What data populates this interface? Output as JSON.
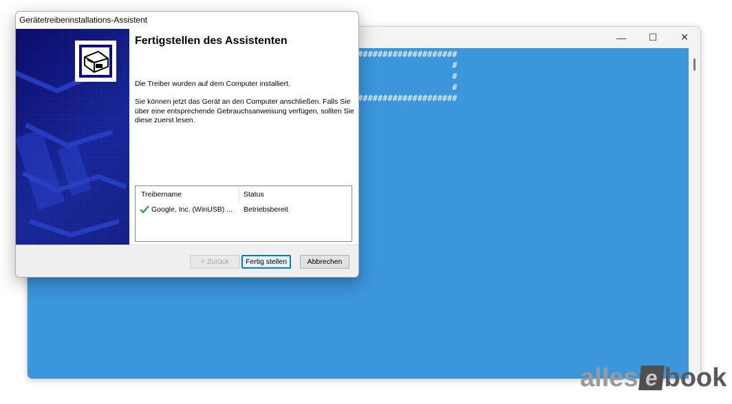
{
  "console": {
    "min_glyph": "—",
    "max_glyph": "☐",
    "close_glyph": "✕",
    "lines": [
      "####################",
      "                   #",
      "                   #",
      "                   #",
      "####################"
    ],
    "background_color": "#3b96dc"
  },
  "dialog": {
    "title": "Gerätetreiberinstallations-Assistent",
    "heading": "Fertigstellen des Assistenten",
    "paragraph1": "Die Treiber wurden auf dem Computer installiert.",
    "paragraph2": "Sie können jetzt das Gerät an den Computer anschließen. Falls Sie über eine entsprechende Gebrauchsanweisung verfügen, sollten Sie diese zuerst lesen.",
    "side_icon": "hardware-device-icon",
    "driver_list": {
      "columns": [
        "Treibername",
        "Status"
      ],
      "rows": [
        {
          "icon": "checkmark-icon",
          "name": "Google, Inc. (WinUSB) ...",
          "status": "Betriebsbereit"
        }
      ]
    },
    "buttons": {
      "back": "< Zurück",
      "finish": "Fertig stellen",
      "cancel": "Abbrechen"
    }
  },
  "watermark": {
    "part1": "alles",
    "part2": "e",
    "part3": "book"
  }
}
